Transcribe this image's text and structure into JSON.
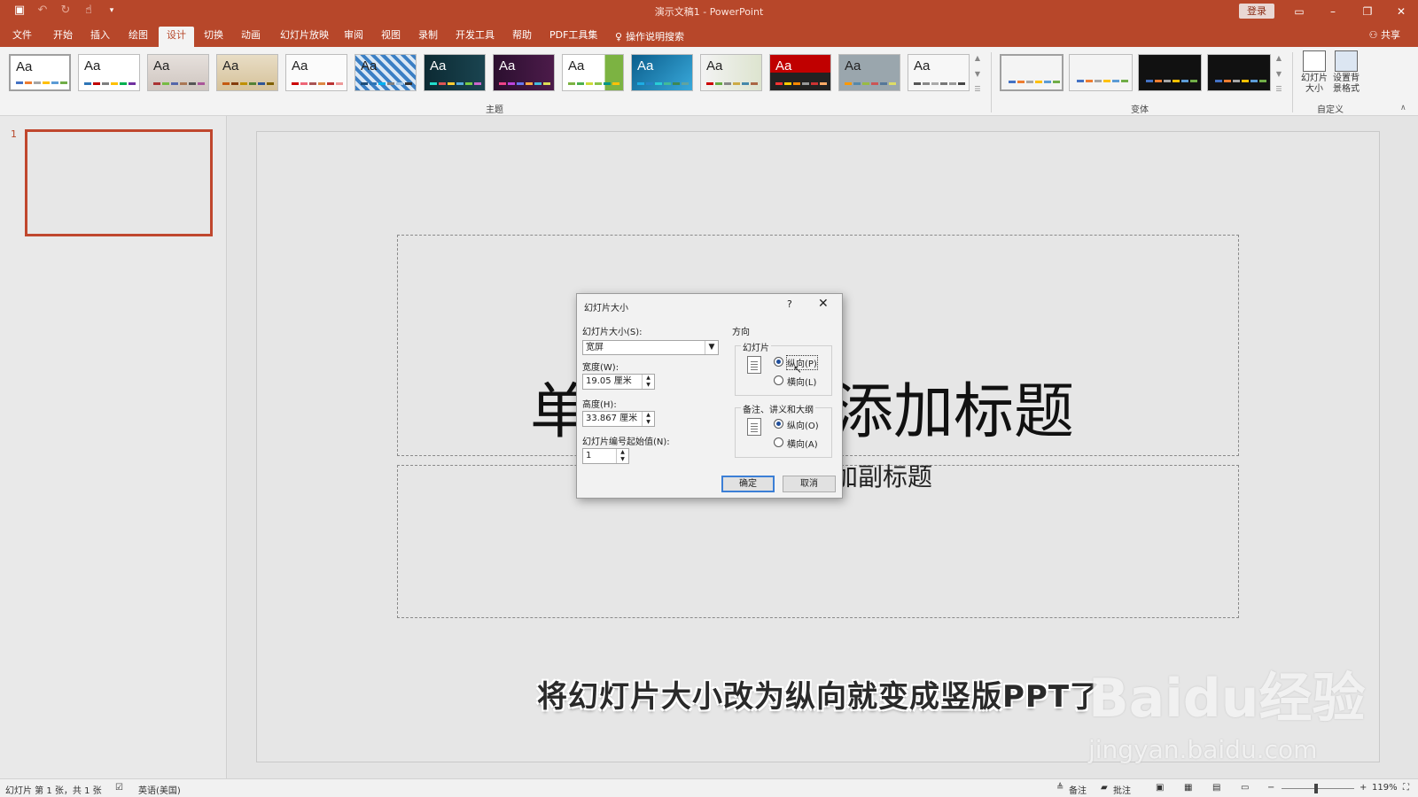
{
  "window": {
    "title": "演示文稿1 - PowerPoint",
    "login_label": "登录",
    "share_label": "共享"
  },
  "tabs": [
    {
      "label": "文件"
    },
    {
      "label": "开始"
    },
    {
      "label": "插入"
    },
    {
      "label": "绘图"
    },
    {
      "label": "设计",
      "active": true
    },
    {
      "label": "切换"
    },
    {
      "label": "动画"
    },
    {
      "label": "幻灯片放映"
    },
    {
      "label": "审阅"
    },
    {
      "label": "视图"
    },
    {
      "label": "录制"
    },
    {
      "label": "开发工具"
    },
    {
      "label": "帮助"
    },
    {
      "label": "PDF工具集"
    },
    {
      "label": "操作说明搜索"
    }
  ],
  "ribbon": {
    "themes_group": "主题",
    "variants_group": "变体",
    "customize_group": "自定义",
    "theme_glyph": "Aa",
    "slide_size_label": "幻灯片大小",
    "format_bg_label": "设置背景格式"
  },
  "thumbnails": {
    "first_number": "1"
  },
  "slide": {
    "title_left": "单",
    "title_right": "添加标题",
    "subtitle_right": "加副标题",
    "caption": "将幻灯片大小改为纵向就变成竖版PPT了"
  },
  "dialog": {
    "title": "幻灯片大小",
    "help": "?",
    "size_label": "幻灯片大小(S):",
    "size_value": "宽屏",
    "width_label": "宽度(W):",
    "width_value": "19.05 厘米",
    "height_label": "高度(H):",
    "height_value": "33.867 厘米",
    "start_label": "幻灯片编号起始值(N):",
    "start_value": "1",
    "orientation_label": "方向",
    "slides_label": "幻灯片",
    "slides_portrait": "纵向(P)",
    "slides_landscape": "横向(L)",
    "notes_label": "备注、讲义和大纲",
    "notes_portrait": "纵向(O)",
    "notes_landscape": "横向(A)",
    "ok_label": "确定",
    "cancel_label": "取消"
  },
  "status": {
    "slide_info": "幻灯片 第 1 张，共 1 张",
    "language": "英语(美国)",
    "notes": "备注",
    "comments": "批注",
    "zoom_minus": "−",
    "zoom_plus": "+",
    "zoom": "119%"
  },
  "watermark": {
    "line1": "Baidu经验",
    "line2": "jingyan.baidu.com"
  },
  "colors": {
    "accent": "#b7472a"
  }
}
